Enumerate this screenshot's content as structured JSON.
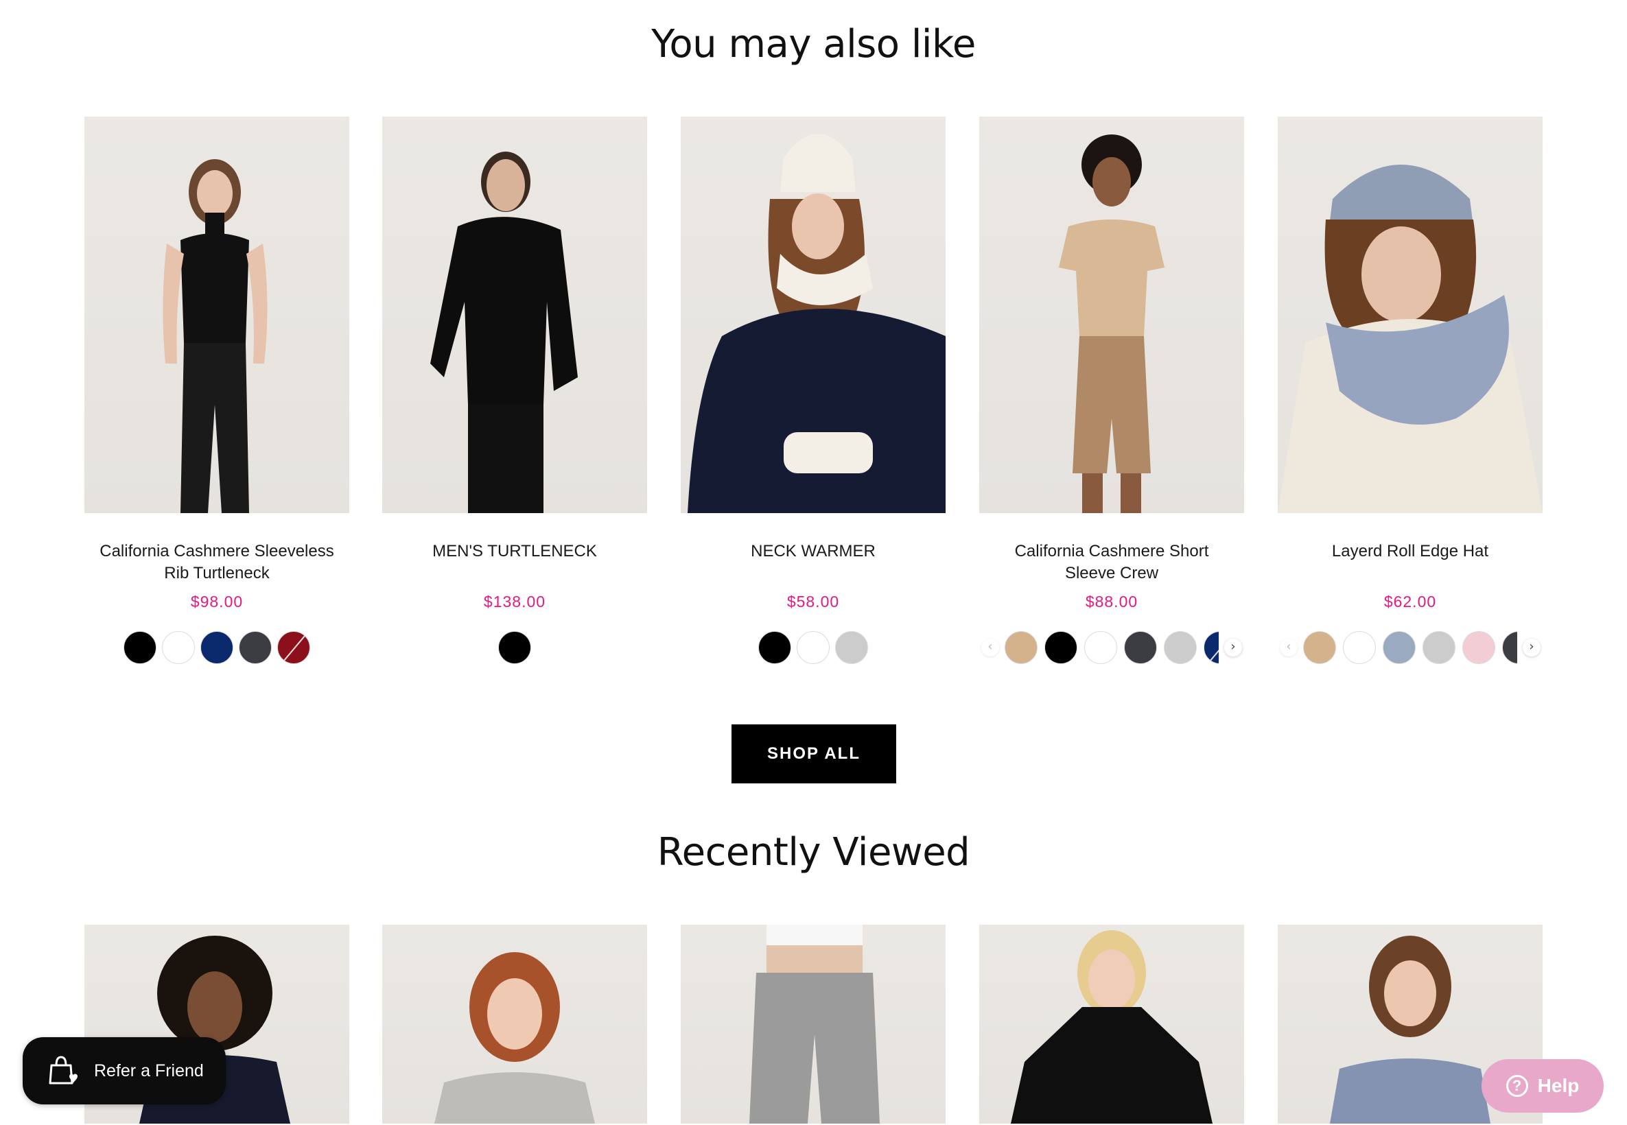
{
  "sections": {
    "also_like_title": "You may also like",
    "recent_title": "Recently Viewed"
  },
  "products": [
    {
      "name": "California Cashmere Sleeveless Rib Turtleneck",
      "price": "$98.00",
      "swatches": [
        "#000000",
        "#ffffff",
        "#0b2a6e",
        "#3b3d42",
        "#8c0f1c"
      ],
      "carousel": false
    },
    {
      "name": "MEN'S TURTLENECK",
      "price": "$138.00",
      "swatches": [
        "#000000"
      ],
      "carousel": false
    },
    {
      "name": "NECK WARMER",
      "price": "$58.00",
      "swatches": [
        "#000000",
        "#ffffff",
        "#cccccc"
      ],
      "carousel": false
    },
    {
      "name": "California Cashmere Short Sleeve Crew",
      "price": "$88.00",
      "swatches": [
        "#d4b28c",
        "#000000",
        "#ffffff",
        "#3b3d42",
        "#cccccc",
        "#0b2a6e"
      ],
      "carousel": true
    },
    {
      "name": "Layerd Roll Edge Hat",
      "price": "$62.00",
      "swatches": [
        "#d4b28c",
        "#ffffff",
        "#9aaac0",
        "#cccccc",
        "#f2cdd6",
        "#3b3d42"
      ],
      "carousel": true
    }
  ],
  "shop_all_label": "SHOP ALL",
  "refer": {
    "label": "Refer a Friend",
    "icon": "shopping-bag-heart-icon"
  },
  "help": {
    "label": "Help",
    "icon": "question-circle-icon"
  },
  "colors": {
    "price": "#e6197f",
    "help_bg": "#e7a8c9",
    "button_bg": "#000000"
  }
}
